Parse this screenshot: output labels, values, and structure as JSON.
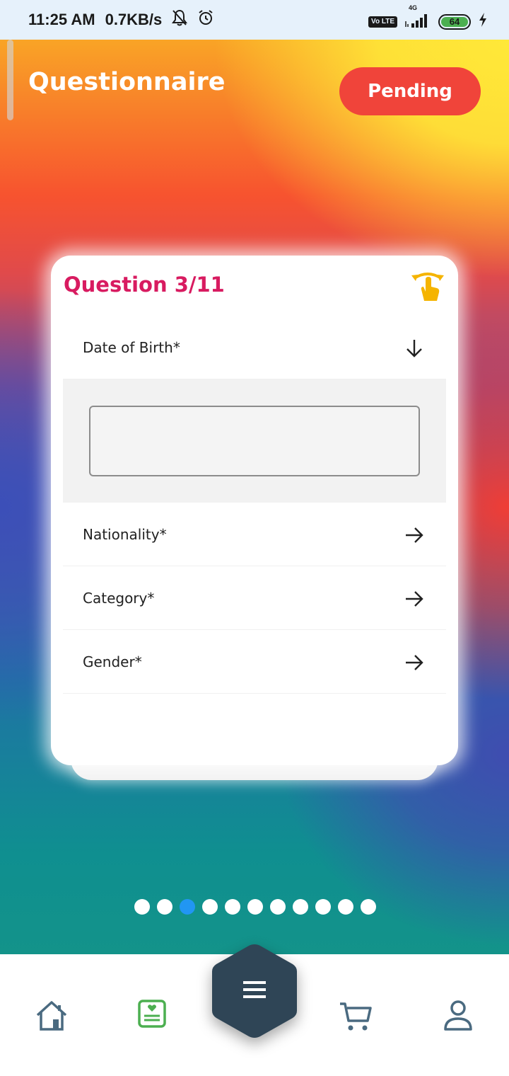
{
  "status_bar": {
    "time": "11:25 AM",
    "speed": "0.7KB/s",
    "network": "4G",
    "volte": "Vo LTE",
    "battery": "64"
  },
  "header": {
    "title": "Questionnaire",
    "status_button": "Pending"
  },
  "card": {
    "question_counter": "Question 3/11",
    "items": [
      {
        "label": "Date of Birth*",
        "expanded": true,
        "input_value": ""
      },
      {
        "label": "Nationality*",
        "expanded": false
      },
      {
        "label": "Category*",
        "expanded": false
      },
      {
        "label": "Gender*",
        "expanded": false
      }
    ]
  },
  "pagination": {
    "total": 11,
    "current": 3
  },
  "bottom_nav": {
    "items": [
      "home-icon",
      "questionnaire-icon",
      "menu-icon",
      "cart-icon",
      "profile-icon"
    ],
    "active": "questionnaire-icon"
  },
  "colors": {
    "accent": "#d81b60",
    "pending": "#f0443a",
    "active_dot": "#2196f3",
    "nav_active": "#4caf50",
    "nav_icon": "#4a6a80",
    "menu_hex": "#2f4556"
  }
}
